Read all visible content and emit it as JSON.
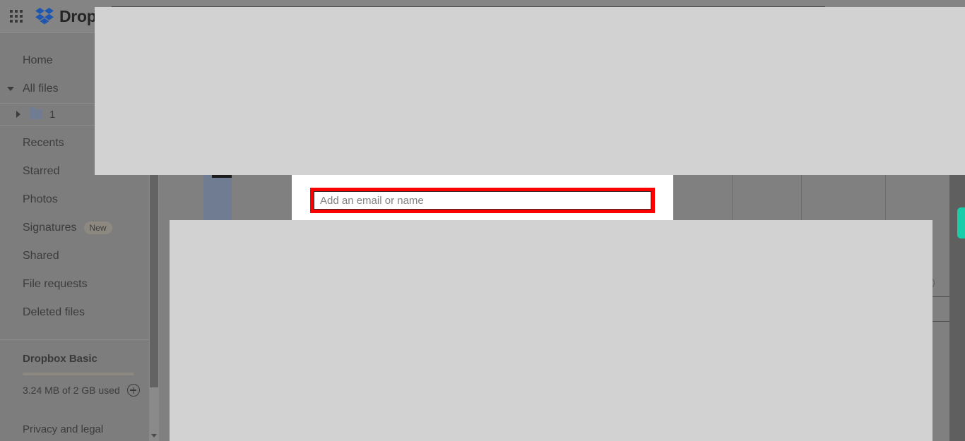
{
  "app": {
    "brand_name": "Dropbox",
    "apps_grid_icon": "grid-apps-icon",
    "logo_icon": "dropbox-logo-icon"
  },
  "sidebar": {
    "items": [
      {
        "label": "Home",
        "icon": ""
      },
      {
        "label": "All files",
        "icon": "chevron-down-icon"
      },
      {
        "label": "Recents",
        "icon": ""
      },
      {
        "label": "Starred",
        "icon": ""
      },
      {
        "label": "Photos",
        "icon": ""
      },
      {
        "label": "Signatures",
        "icon": "",
        "badge": "New"
      },
      {
        "label": "Shared",
        "icon": ""
      },
      {
        "label": "File requests",
        "icon": ""
      },
      {
        "label": "Deleted files",
        "icon": ""
      }
    ],
    "tree": {
      "expand_icon": "chevron-right-icon",
      "folder_icon": "folder-icon",
      "label": "1"
    },
    "plan": {
      "title": "Dropbox Basic",
      "usage": "3.24 MB of 2 GB used",
      "upgrade_icon": "plus-circle-icon"
    },
    "legal": "Privacy and legal",
    "scrollbar": {
      "down_arrow_icon": "chevron-down-icon"
    }
  },
  "share_dialog": {
    "email_input": {
      "placeholder": "Add an email or name",
      "value": ""
    }
  },
  "feedback_tab": {
    "label": "",
    "icon": "feedback-tab-icon"
  },
  "colors": {
    "dim_backdrop": "#808080",
    "overlay_panel": "#d2d2d2",
    "modal_white": "#ffffff",
    "highlight": "#ff0000",
    "brand_blue": "#1e56b0",
    "teal_accent": "#19ccaa",
    "sidebar": "#7d7d7d"
  }
}
